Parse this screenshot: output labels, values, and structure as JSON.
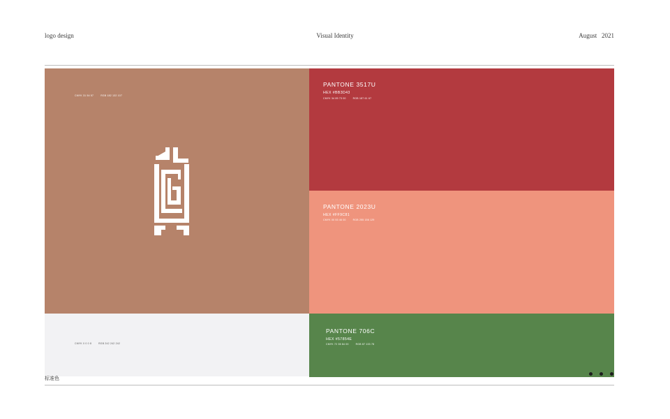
{
  "header": {
    "left": "logo design",
    "center": "Visual Identity",
    "right": "August   2021"
  },
  "primary_color": {
    "hex_value": "#B6836A",
    "cmyk": "CMYK 31 54 57",
    "rgb": "RGB 182 132 107",
    "logo_color": "#FFFFFF"
  },
  "neutral_color": {
    "hex_value": "#F2F2F4",
    "cmyk": "CMYK 0 0 0 8",
    "rgb": "RGB 242 242 242"
  },
  "swatches": [
    {
      "pantone": "PANTONE 3517U",
      "hex": "HEX #BB3D43",
      "cmyk": "CMYK 34 89 73 00",
      "rgb": "RGB 187 61 67",
      "color": "#B33A3F"
    },
    {
      "pantone": "PANTONE 2023U",
      "hex": "HEX #FF9C81",
      "cmyk": "CMYK 00 53 46 00",
      "rgb": "RGB 255 156 129",
      "color": "#EF947D"
    },
    {
      "pantone": "PANTONE 706C",
      "hex": "HEX #57854E",
      "cmyk": "CMYK 72 35 84 00",
      "rgb": "RGB 87 133 78",
      "color": "#57854B"
    }
  ],
  "footer": {
    "caption": "标准色"
  },
  "pagination": {
    "count": 3
  }
}
